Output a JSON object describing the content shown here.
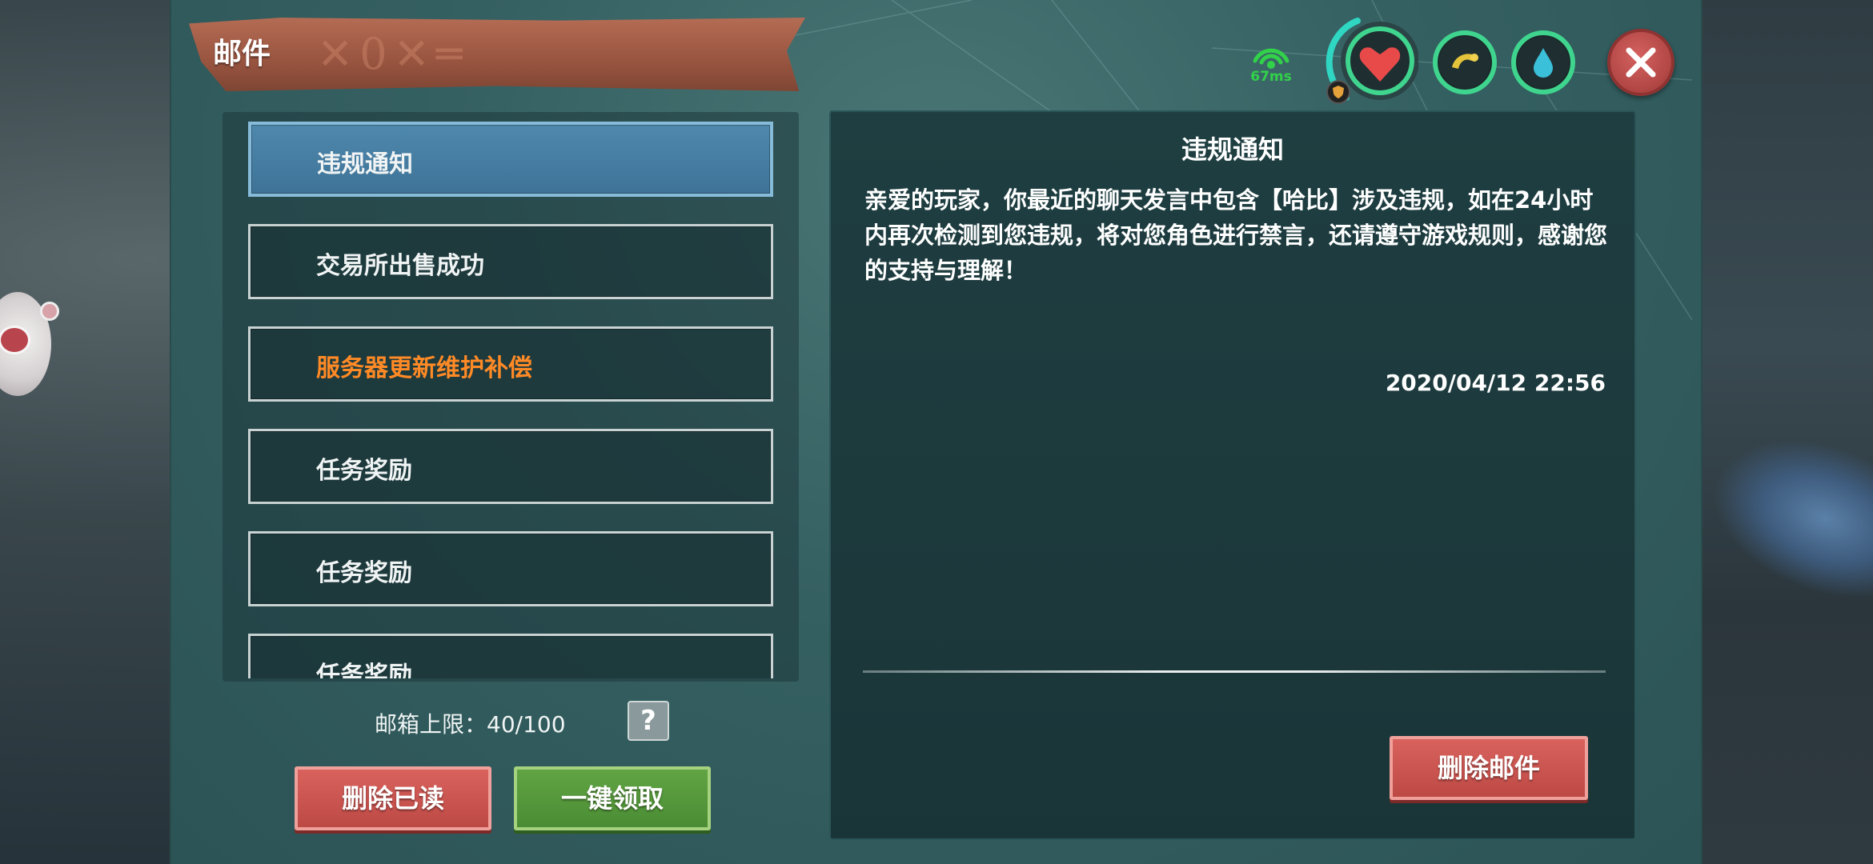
{
  "window": {
    "title": "邮件"
  },
  "status": {
    "ping": "67ms",
    "colors": {
      "ring": "#3fd58e",
      "health": "#e84a4a",
      "hunger": "#e4c43a",
      "water": "#3ac0d8"
    }
  },
  "mail_list": {
    "items": [
      {
        "label": "违规通知",
        "state": "selected"
      },
      {
        "label": "交易所出售成功",
        "state": "normal"
      },
      {
        "label": "服务器更新维护补偿",
        "state": "highlight"
      },
      {
        "label": "任务奖励",
        "state": "normal"
      },
      {
        "label": "任务奖励",
        "state": "normal"
      },
      {
        "label": "任务奖励",
        "state": "normal"
      }
    ],
    "capacity_label": "邮箱上限：40/100",
    "help_label": "?"
  },
  "actions": {
    "delete_read": "删除已读",
    "claim_all": "一键领取",
    "delete_mail": "删除邮件"
  },
  "reader": {
    "title": "违规通知",
    "body": "亲爱的玩家，你最近的聊天发言中包含【哈比】涉及违规，如在24小时内再次检测到您违规，将对您角色进行禁言，还请遵守游戏规则，感谢您的支持与理解！",
    "date": "2020/04/12 22:56"
  },
  "icons": {
    "signal": "signal-icon",
    "health": "heart-icon",
    "hunger": "food-icon",
    "water": "water-drop-icon",
    "close": "close-icon",
    "help": "question-icon",
    "shield": "shield-icon"
  }
}
